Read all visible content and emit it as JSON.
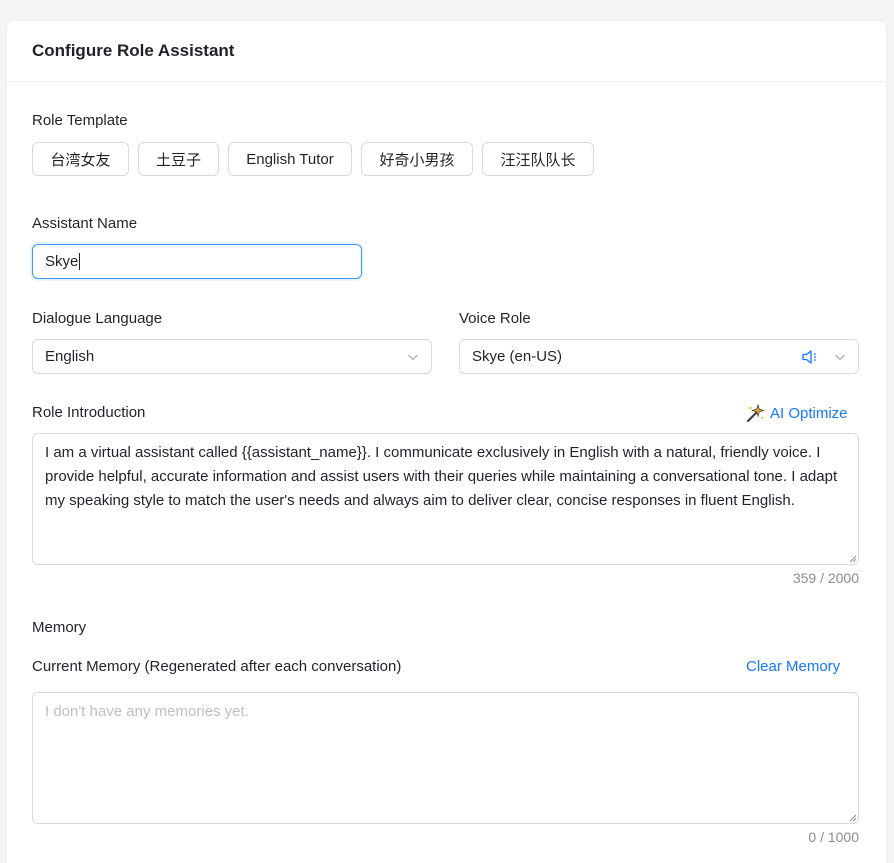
{
  "header": {
    "title": "Configure Role Assistant"
  },
  "role_template": {
    "label": "Role Template",
    "options": [
      "台湾女友",
      "土豆子",
      "English Tutor",
      "好奇小男孩",
      "汪汪队队长"
    ]
  },
  "assistant_name": {
    "label": "Assistant Name",
    "value": "Skye"
  },
  "dialogue_language": {
    "label": "Dialogue Language",
    "value": "English"
  },
  "voice_role": {
    "label": "Voice Role",
    "value": "Skye (en-US)"
  },
  "role_intro": {
    "label": "Role Introduction",
    "ai_optimize": "AI Optimize",
    "value": "I am a virtual assistant called {{assistant_name}}. I communicate exclusively in English with a natural, friendly voice. I provide helpful, accurate information and assist users with their queries while maintaining a conversational tone. I adapt my speaking style to match the user's needs and always aim to deliver clear, concise responses in fluent English.",
    "counter": "359 / 2000"
  },
  "memory": {
    "section_label": "Memory",
    "current_label": "Current Memory (Regenerated after each conversation)",
    "clear_label": "Clear Memory",
    "placeholder": "I don't have any memories yet.",
    "counter": "0 / 1000"
  },
  "colors": {
    "accent": "#1677ff",
    "focus_border": "#4096ff",
    "border": "#d9d9d9",
    "muted": "#8c8c8c"
  }
}
